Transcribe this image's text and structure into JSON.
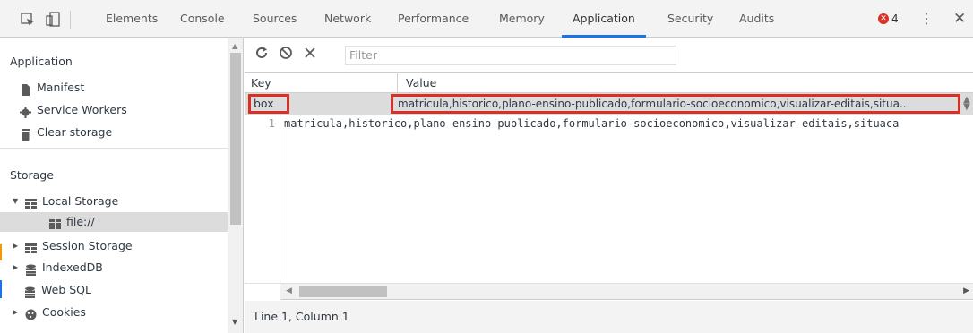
{
  "tabs": [
    {
      "label": "Elements"
    },
    {
      "label": "Console"
    },
    {
      "label": "Sources"
    },
    {
      "label": "Network"
    },
    {
      "label": "Performance"
    },
    {
      "label": "Memory"
    },
    {
      "label": "Application"
    },
    {
      "label": "Security"
    },
    {
      "label": "Audits"
    }
  ],
  "active_tab": "Application",
  "error_count": "4",
  "sidebar": {
    "application_heading": "Application",
    "application_items": [
      {
        "label": "Manifest",
        "icon": "file-icon"
      },
      {
        "label": "Service Workers",
        "icon": "gear-icon"
      },
      {
        "label": "Clear storage",
        "icon": "trash-icon"
      }
    ],
    "storage_heading": "Storage",
    "storage_items": [
      {
        "label": "Local Storage",
        "icon": "grid-icon",
        "expanded": true
      },
      {
        "label": "file://",
        "icon": "grid-icon",
        "selected": true
      },
      {
        "label": "Session Storage",
        "icon": "grid-icon"
      },
      {
        "label": "IndexedDB",
        "icon": "database-icon"
      },
      {
        "label": "Web SQL",
        "icon": "database-icon"
      },
      {
        "label": "Cookies",
        "icon": "cookie-icon"
      }
    ]
  },
  "toolbar": {
    "filter_placeholder": "Filter"
  },
  "grid": {
    "key_header": "Key",
    "value_header": "Value",
    "row": {
      "key": "box",
      "value": "matricula,historico,plano-ensino-publicado,formulario-socioeconomico,visualizar-editais,situa..."
    }
  },
  "editor": {
    "line_number": "1",
    "text": "matricula,historico,plano-ensino-publicado,formulario-socioeconomico,visualizar-editais,situaca"
  },
  "status": "Line 1, Column 1",
  "colors": {
    "highlight_border": "#d93025",
    "active_tab_underline": "#1a73e8",
    "selected_row": "#dcdcdc"
  }
}
